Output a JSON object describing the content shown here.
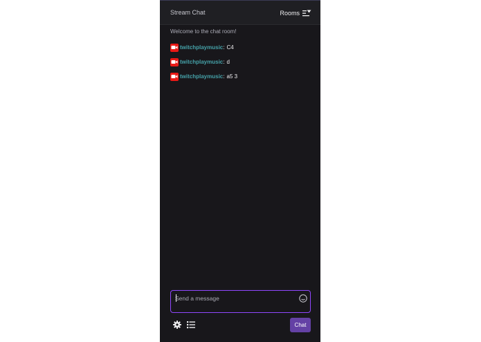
{
  "header": {
    "title": "Stream Chat",
    "rooms_label": "Rooms",
    "rooms_icon": "filter-sort-icon"
  },
  "chat": {
    "welcome": "Welcome to the chat room!",
    "messages": [
      {
        "badge_icon": "broadcaster-camera-icon",
        "user": "twitchplaymusic",
        "text": "C4"
      },
      {
        "badge_icon": "broadcaster-camera-icon",
        "user": "twitchplaymusic",
        "text": "d"
      },
      {
        "badge_icon": "broadcaster-camera-icon",
        "user": "twitchplaymusic",
        "text": "a5 3"
      }
    ]
  },
  "input": {
    "placeholder": "Send a message",
    "value": "",
    "emoji_icon": "smiley-icon"
  },
  "footer": {
    "settings_icon": "gear-icon",
    "list_icon": "list-icon",
    "chat_button": "Chat"
  },
  "colors": {
    "background": "#18171b",
    "username": "#45a1a8",
    "accent": "#6441a5",
    "badge": "#e91916",
    "input_border": "#9147ff"
  }
}
